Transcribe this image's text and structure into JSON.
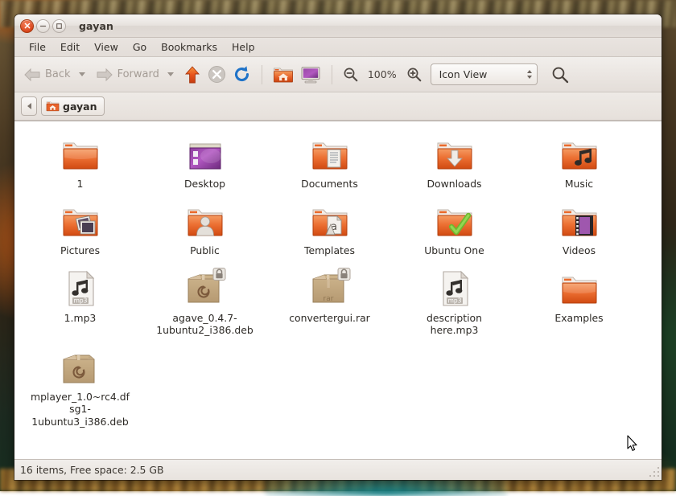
{
  "window": {
    "title": "gayan",
    "controls": {
      "close": "×",
      "minimize": "−",
      "maximize": "□"
    }
  },
  "menubar": {
    "items": [
      {
        "label": "File"
      },
      {
        "label": "Edit"
      },
      {
        "label": "View"
      },
      {
        "label": "Go"
      },
      {
        "label": "Bookmarks"
      },
      {
        "label": "Help"
      }
    ]
  },
  "toolbar": {
    "back_label": "Back",
    "forward_label": "Forward",
    "up_icon": "up-arrow-icon",
    "stop_icon": "stop-icon",
    "reload_icon": "reload-icon",
    "home_icon": "home-folder-icon",
    "computer_icon": "computer-icon",
    "zoom_out_icon": "zoom-out-icon",
    "zoom_level": "100%",
    "zoom_in_icon": "zoom-in-icon",
    "view_mode": "Icon View",
    "search_icon": "search-icon"
  },
  "pathbar": {
    "prev_icon": "chevron-left-icon",
    "crumb": "gayan",
    "crumb_icon": "home-folder-icon"
  },
  "files": [
    {
      "name": "1",
      "icon": "folder",
      "selected": true
    },
    {
      "name": "Desktop",
      "icon": "folder-desktop"
    },
    {
      "name": "Documents",
      "icon": "folder-documents"
    },
    {
      "name": "Downloads",
      "icon": "folder-downloads"
    },
    {
      "name": "Music",
      "icon": "folder-music"
    },
    {
      "name": "Pictures",
      "icon": "folder-pictures"
    },
    {
      "name": "Public",
      "icon": "folder-public"
    },
    {
      "name": "Templates",
      "icon": "folder-templates"
    },
    {
      "name": "Ubuntu One",
      "icon": "folder-ubuntuone"
    },
    {
      "name": "Videos",
      "icon": "folder-videos"
    },
    {
      "name": "1.mp3",
      "icon": "file-mp3"
    },
    {
      "name": "agave_0.4.7-1ubuntu2_i386.deb",
      "icon": "package-deb",
      "badge": "lock"
    },
    {
      "name": "convertergui.rar",
      "icon": "package-rar",
      "badge": "lock"
    },
    {
      "name": "description here.mp3",
      "icon": "file-mp3"
    },
    {
      "name": "Examples",
      "icon": "folder"
    },
    {
      "name": "mplayer_1.0~rc4.dfsg1-1ubuntu3_i386.deb",
      "icon": "package-deb"
    }
  ],
  "statusbar": {
    "text": "16 items, Free space: 2.5 GB"
  },
  "colors": {
    "folder_orange": "#e8622a",
    "accent": "#dd4814",
    "chrome": "#e8e3de",
    "package_tan": "#c2a578"
  }
}
